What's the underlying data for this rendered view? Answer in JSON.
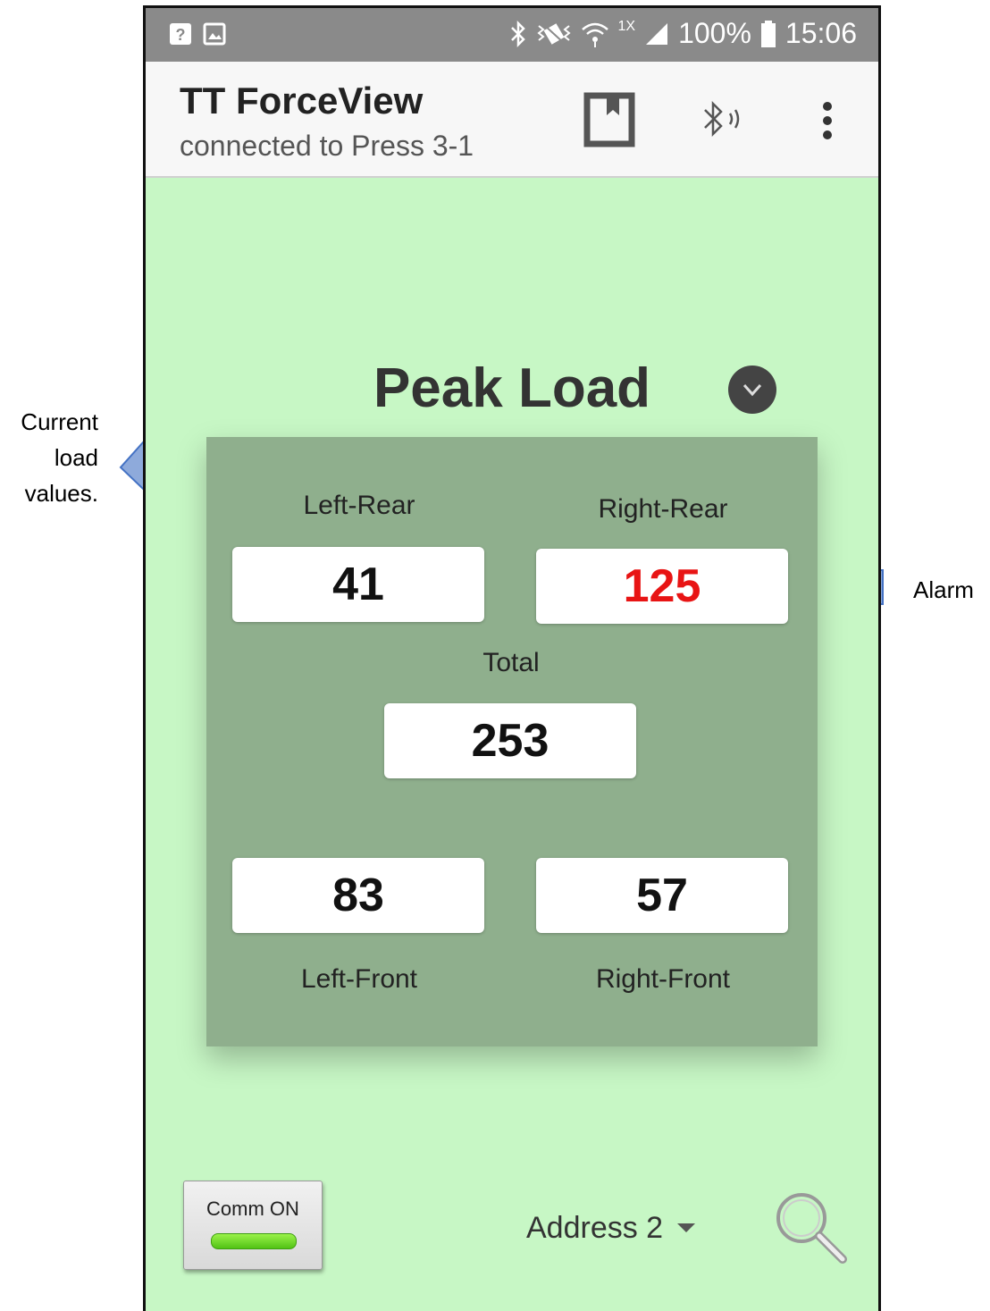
{
  "annotations": {
    "left_callout": [
      "Current",
      "load",
      "values."
    ],
    "right_callout": "Alarm"
  },
  "status_bar": {
    "left_icons": [
      "help-icon",
      "image-icon"
    ],
    "right_icons": [
      "bluetooth-icon",
      "vibrate-icon",
      "wifi-icon",
      "signal-icon"
    ],
    "network_tag": "1X",
    "battery": "100%",
    "time": "15:06"
  },
  "app_bar": {
    "title": "TT ForceView",
    "subtitle": "connected to Press 3-1",
    "actions": [
      "bookmark-icon",
      "bluetooth-connected-icon",
      "more-vert-icon"
    ]
  },
  "main": {
    "mode_title": "Peak Load",
    "readings": {
      "left_rear": {
        "label": "Left-Rear",
        "value": "41"
      },
      "right_rear": {
        "label": "Right-Rear",
        "value": "125",
        "alarm": true
      },
      "total": {
        "label": "Total",
        "value": "253"
      },
      "left_front": {
        "label": "Left-Front",
        "value": "83"
      },
      "right_front": {
        "label": "Right-Front",
        "value": "57"
      }
    }
  },
  "footer": {
    "comm_button": "Comm ON",
    "address": "Address 2"
  },
  "colors": {
    "background": "#c7f7c5",
    "panel": "#8faf8d",
    "alarm": "#e81414",
    "led": "#6ad61e",
    "arrow_fill": "#8eaadb",
    "arrow_stroke": "#4472c4"
  }
}
